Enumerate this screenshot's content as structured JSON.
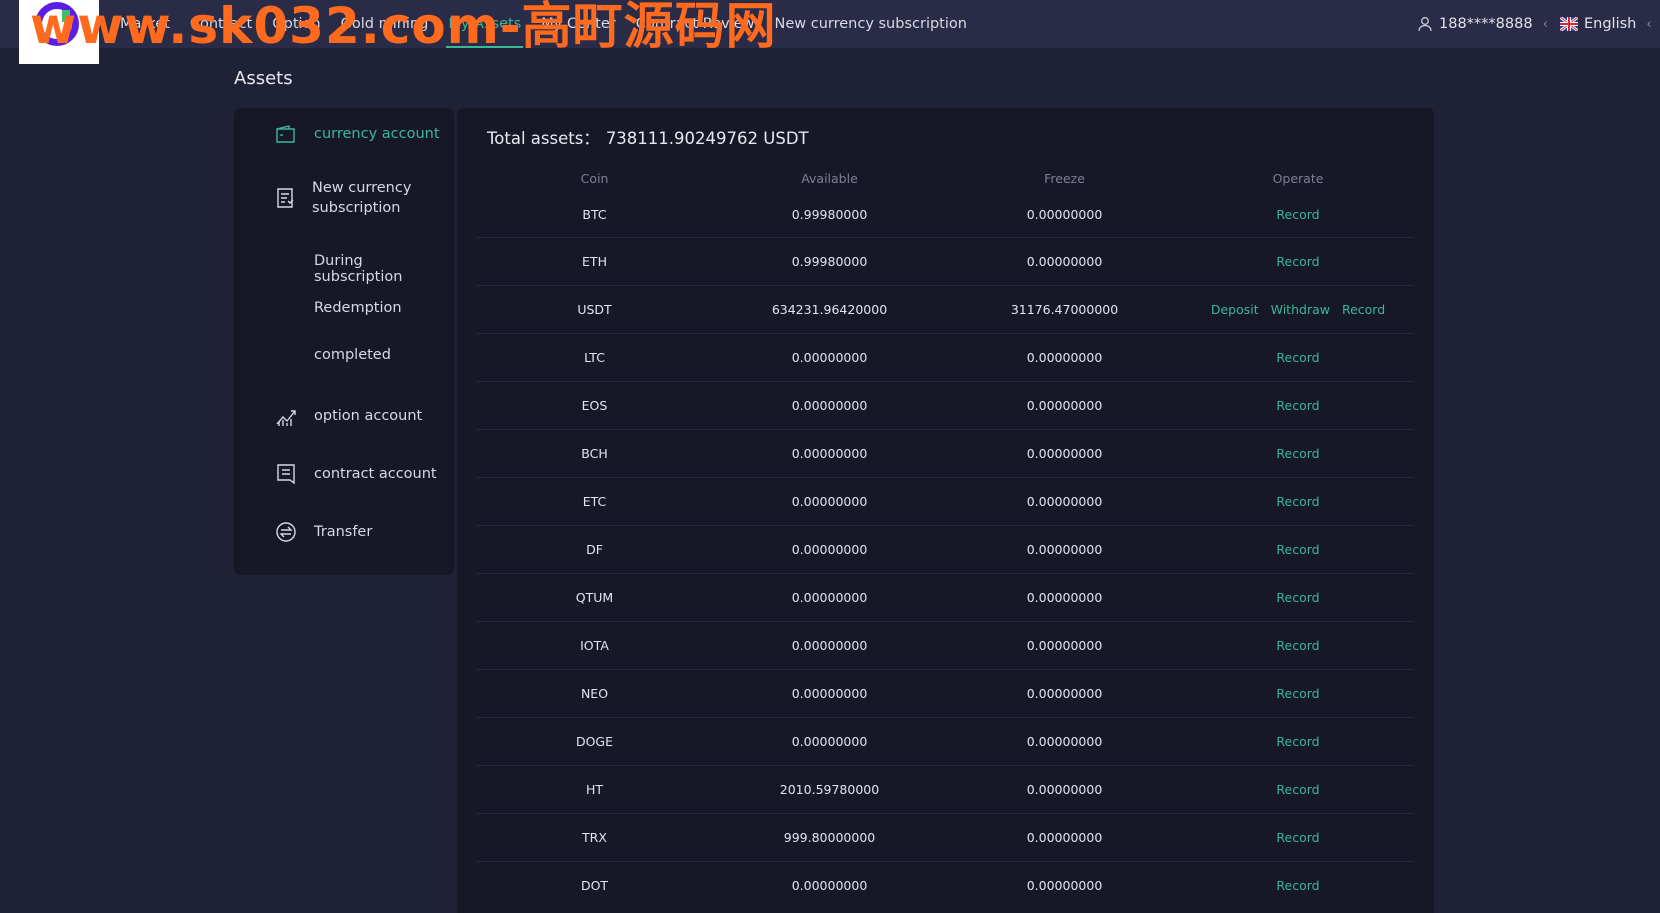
{
  "watermark": "www.sk032.com-高町源码网",
  "nav": {
    "items": [
      "Market",
      "Contract",
      "Option",
      "Gold mining",
      "My Assets",
      "My Center",
      "Contract Review",
      "New currency subscription"
    ],
    "active_index": 4
  },
  "user": {
    "account": "188****8888"
  },
  "language": {
    "label": "English"
  },
  "page_title": "Assets",
  "sidebar": {
    "currency_account": "currency account",
    "new_currency_line1": "New currency",
    "new_currency_line2": "subscription",
    "during_subscription": "During subscription",
    "redemption": "Redemption",
    "completed": "completed",
    "option_account": "option account",
    "contract_account": "contract account",
    "transfer": "Transfer"
  },
  "total_assets": {
    "label": "Total assets：",
    "value": "738111.90249762 USDT"
  },
  "table": {
    "headers": [
      "Coin",
      "Available",
      "Freeze",
      "Operate"
    ],
    "actions": {
      "deposit": "Deposit",
      "withdraw": "Withdraw",
      "record": "Record"
    },
    "rows": [
      {
        "coin": "BTC",
        "available": "0.99980000",
        "freeze": "0.00000000",
        "actions": [
          "record"
        ]
      },
      {
        "coin": "ETH",
        "available": "0.99980000",
        "freeze": "0.00000000",
        "actions": [
          "record"
        ]
      },
      {
        "coin": "USDT",
        "available": "634231.96420000",
        "freeze": "31176.47000000",
        "actions": [
          "deposit",
          "withdraw",
          "record"
        ]
      },
      {
        "coin": "LTC",
        "available": "0.00000000",
        "freeze": "0.00000000",
        "actions": [
          "record"
        ]
      },
      {
        "coin": "EOS",
        "available": "0.00000000",
        "freeze": "0.00000000",
        "actions": [
          "record"
        ]
      },
      {
        "coin": "BCH",
        "available": "0.00000000",
        "freeze": "0.00000000",
        "actions": [
          "record"
        ]
      },
      {
        "coin": "ETC",
        "available": "0.00000000",
        "freeze": "0.00000000",
        "actions": [
          "record"
        ]
      },
      {
        "coin": "DF",
        "available": "0.00000000",
        "freeze": "0.00000000",
        "actions": [
          "record"
        ]
      },
      {
        "coin": "QTUM",
        "available": "0.00000000",
        "freeze": "0.00000000",
        "actions": [
          "record"
        ]
      },
      {
        "coin": "IOTA",
        "available": "0.00000000",
        "freeze": "0.00000000",
        "actions": [
          "record"
        ]
      },
      {
        "coin": "NEO",
        "available": "0.00000000",
        "freeze": "0.00000000",
        "actions": [
          "record"
        ]
      },
      {
        "coin": "DOGE",
        "available": "0.00000000",
        "freeze": "0.00000000",
        "actions": [
          "record"
        ]
      },
      {
        "coin": "HT",
        "available": "2010.59780000",
        "freeze": "0.00000000",
        "actions": [
          "record"
        ]
      },
      {
        "coin": "TRX",
        "available": "999.80000000",
        "freeze": "0.00000000",
        "actions": [
          "record"
        ]
      },
      {
        "coin": "DOT",
        "available": "0.00000000",
        "freeze": "0.00000000",
        "actions": [
          "record"
        ]
      }
    ]
  },
  "colors": {
    "accent": "#3bb794",
    "background": "#1f2137",
    "panel": "#171827",
    "topbar": "#2a2c47",
    "watermark": "#ff6a1f"
  }
}
